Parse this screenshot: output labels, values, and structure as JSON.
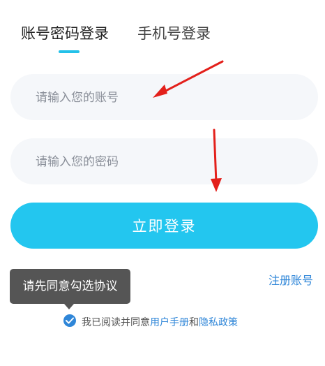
{
  "tabs": [
    {
      "label": "账号密码登录",
      "active": true
    },
    {
      "label": "手机号登录",
      "active": false
    }
  ],
  "form": {
    "account_placeholder": "请输入您的账号",
    "password_placeholder": "请输入您的密码",
    "login_button": "立即登录"
  },
  "register_link": "注册账号",
  "tooltip": "请先同意勾选协议",
  "agreement": {
    "checked": true,
    "prefix": "我已阅读并同意",
    "manual_link": "用户手册",
    "conjunction": "和",
    "privacy_link": "隐私政策"
  },
  "colors": {
    "accent": "#23c6ef",
    "link": "#2f86d8",
    "annotation_arrow": "#e3201b"
  }
}
